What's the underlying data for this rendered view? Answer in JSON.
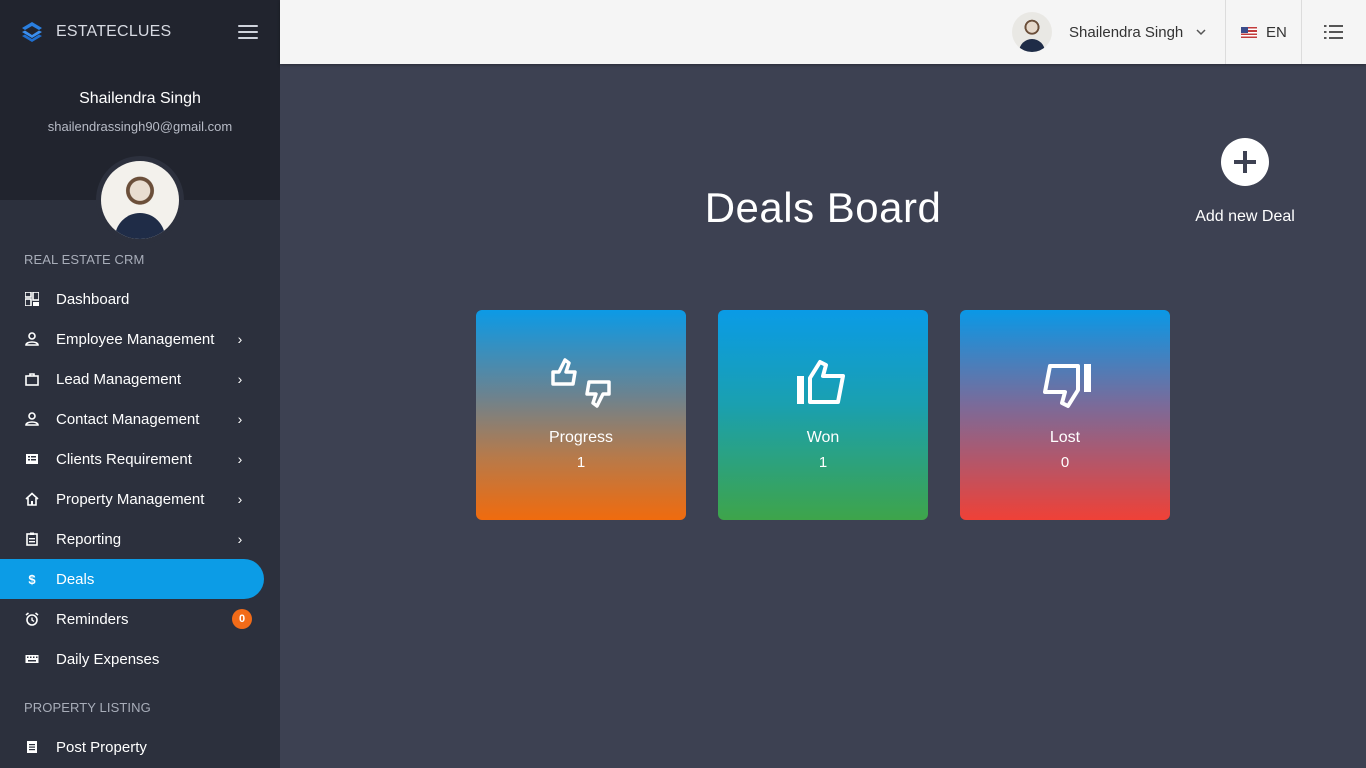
{
  "brand": {
    "name": "ESTATECLUES"
  },
  "profile": {
    "name": "Shailendra Singh",
    "email": "shailendrassingh90@gmail.com"
  },
  "sections": {
    "crm": "REAL ESTATE CRM",
    "listing": "PROPERTY LISTING"
  },
  "menu": [
    {
      "label": "Dashboard",
      "icon": "dashboard-icon"
    },
    {
      "label": "Employee Management",
      "icon": "person-icon"
    },
    {
      "label": "Lead Management",
      "icon": "briefcase-icon"
    },
    {
      "label": "Contact Management",
      "icon": "person-icon"
    },
    {
      "label": "Clients Requirement",
      "icon": "list-icon"
    },
    {
      "label": "Property Management",
      "icon": "home-icon"
    },
    {
      "label": "Reporting",
      "icon": "clipboard-icon"
    },
    {
      "label": "Deals",
      "icon": "dollar-icon",
      "active": true
    },
    {
      "label": "Reminders",
      "icon": "alarm-icon",
      "badge": "0"
    },
    {
      "label": "Daily Expenses",
      "icon": "keyboard-icon"
    }
  ],
  "listing_menu": [
    {
      "label": "Post Property",
      "icon": "document-icon"
    }
  ],
  "topbar": {
    "user_name": "Shailendra Singh",
    "language": "EN"
  },
  "main": {
    "title": "Deals Board",
    "add_label": "Add new Deal",
    "cards": [
      {
        "label": "Progress",
        "count": "1"
      },
      {
        "label": "Won",
        "count": "1"
      },
      {
        "label": "Lost",
        "count": "0"
      }
    ]
  },
  "colors": {
    "accent": "#0c9ce6",
    "badge": "#f26b18",
    "sidebar": "#2c303d",
    "content": "#3d4152"
  }
}
